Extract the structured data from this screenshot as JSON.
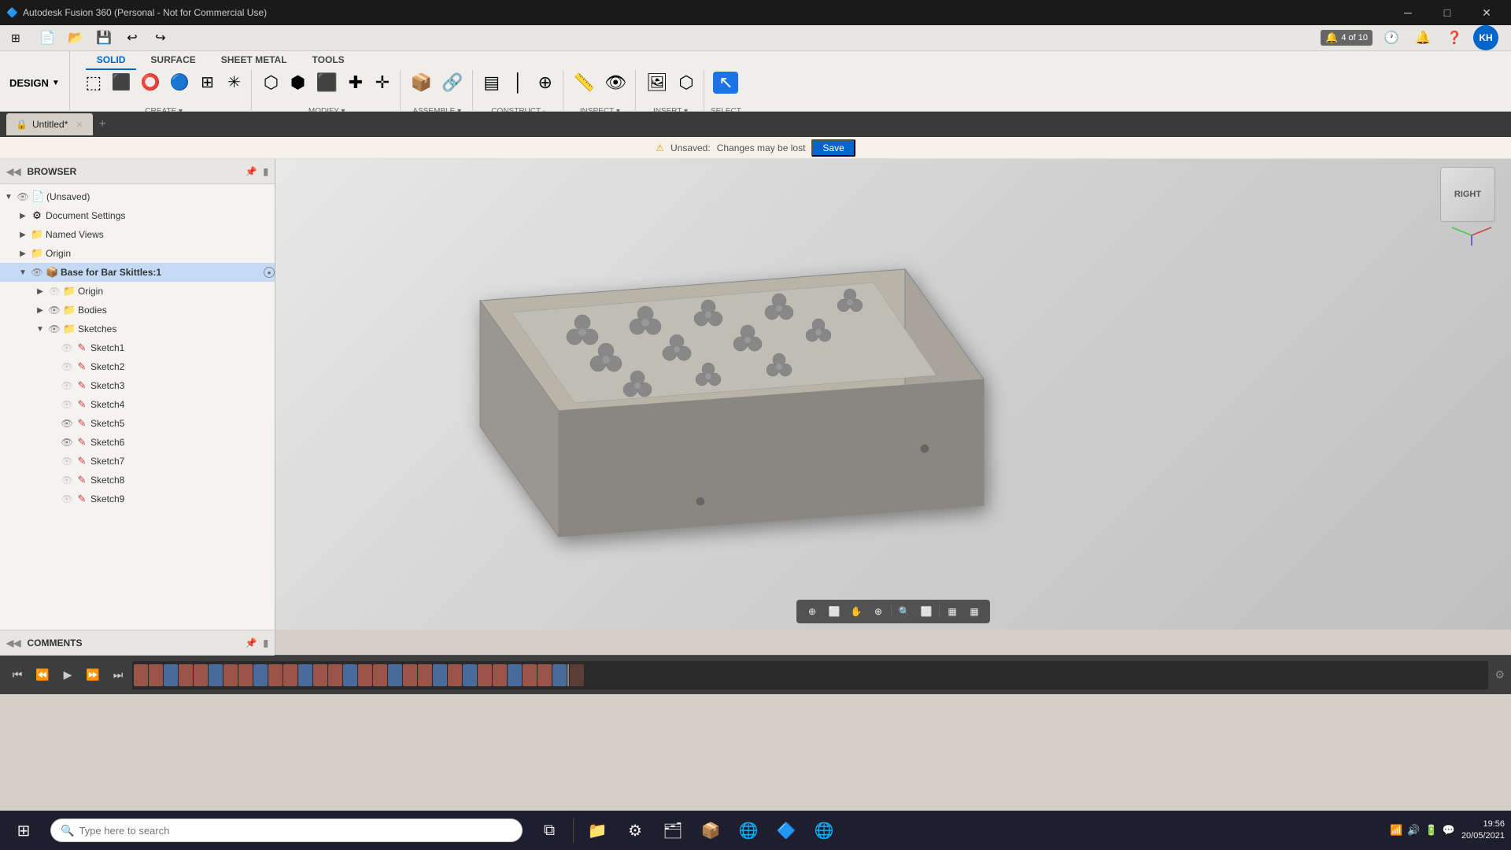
{
  "titlebar": {
    "title": "Autodesk Fusion 360 (Personal - Not for Commercial Use)",
    "icon": "🔷",
    "win_controls": [
      "─",
      "□",
      "✕"
    ]
  },
  "ribbon": {
    "design_label": "DESIGN",
    "tabs": [
      "SOLID",
      "SURFACE",
      "SHEET METAL",
      "TOOLS"
    ],
    "active_tab": "SOLID",
    "groups": {
      "create": {
        "label": "CREATE",
        "items": [
          "new-body",
          "extrude",
          "revolve",
          "sweep",
          "loft",
          "rib",
          "move-copy"
        ]
      },
      "modify": {
        "label": "MODIFY",
        "items": [
          "press-pull",
          "fillet",
          "chamfer",
          "shell",
          "draft",
          "scale",
          "combine"
        ]
      },
      "assemble": {
        "label": "ASSEMBLE",
        "items": [
          "new-component",
          "joint",
          "joint-origin"
        ]
      },
      "construct": {
        "label": "CONSTRUCT",
        "items": [
          "offset-plane",
          "plane-angle",
          "plane-tangent",
          "midplane",
          "axis-cylinder"
        ]
      },
      "inspect": {
        "label": "INSPECT",
        "items": [
          "measure",
          "display-settings"
        ]
      },
      "insert": {
        "label": "INSERT",
        "items": [
          "decal",
          "canvas",
          "insert-mesh"
        ]
      },
      "select": {
        "label": "SELECT",
        "items": [
          "select-tool"
        ]
      }
    }
  },
  "tabbar": {
    "tabs": [
      {
        "id": "untitled",
        "label": "Untitled*",
        "active": true
      }
    ],
    "tab_count": "4 of 10"
  },
  "unsaved": {
    "icon": "⚠",
    "message": "Unsaved:",
    "detail": "Changes may be lost",
    "save_label": "Save"
  },
  "browser": {
    "title": "BROWSER",
    "tree": [
      {
        "id": "root",
        "indent": 0,
        "label": "(Unsaved)",
        "arrow": "▼",
        "icon": "📄",
        "visible": true,
        "bold": false
      },
      {
        "id": "doc-settings",
        "indent": 1,
        "label": "Document Settings",
        "arrow": "▶",
        "icon": "⚙",
        "visible": false,
        "bold": false
      },
      {
        "id": "named-views",
        "indent": 1,
        "label": "Named Views",
        "arrow": "▶",
        "icon": "📁",
        "visible": false,
        "bold": false
      },
      {
        "id": "origin",
        "indent": 1,
        "label": "Origin",
        "arrow": "▶",
        "icon": "📁",
        "visible": false,
        "bold": false
      },
      {
        "id": "base-comp",
        "indent": 1,
        "label": "Base for Bar Skittles:1",
        "arrow": "▼",
        "icon": "📦",
        "visible": true,
        "bold": true,
        "active": true
      },
      {
        "id": "origin2",
        "indent": 2,
        "label": "Origin",
        "arrow": "▶",
        "icon": "📁",
        "visible": false,
        "bold": false
      },
      {
        "id": "bodies",
        "indent": 2,
        "label": "Bodies",
        "arrow": "▶",
        "icon": "📁",
        "visible": true,
        "bold": false
      },
      {
        "id": "sketches",
        "indent": 2,
        "label": "Sketches",
        "arrow": "▼",
        "icon": "📁",
        "visible": true,
        "bold": false
      },
      {
        "id": "sketch1",
        "indent": 3,
        "label": "Sketch1",
        "arrow": "",
        "icon": "✏",
        "visible": false,
        "bold": false,
        "sketch": true
      },
      {
        "id": "sketch2",
        "indent": 3,
        "label": "Sketch2",
        "arrow": "",
        "icon": "✏",
        "visible": false,
        "bold": false,
        "sketch": true
      },
      {
        "id": "sketch3",
        "indent": 3,
        "label": "Sketch3",
        "arrow": "",
        "icon": "✏",
        "visible": false,
        "bold": false,
        "sketch": true
      },
      {
        "id": "sketch4",
        "indent": 3,
        "label": "Sketch4",
        "arrow": "",
        "icon": "✏",
        "visible": false,
        "bold": false,
        "sketch": true
      },
      {
        "id": "sketch5",
        "indent": 3,
        "label": "Sketch5",
        "arrow": "",
        "icon": "✏",
        "visible": true,
        "bold": false,
        "sketch": true
      },
      {
        "id": "sketch6",
        "indent": 3,
        "label": "Sketch6",
        "arrow": "",
        "icon": "✏",
        "visible": true,
        "bold": false,
        "sketch": true
      },
      {
        "id": "sketch7",
        "indent": 3,
        "label": "Sketch7",
        "arrow": "",
        "icon": "✏",
        "visible": false,
        "bold": false,
        "sketch": true
      },
      {
        "id": "sketch8",
        "indent": 3,
        "label": "Sketch8",
        "arrow": "",
        "icon": "✏",
        "visible": false,
        "bold": false,
        "sketch": true
      },
      {
        "id": "sketch9",
        "indent": 3,
        "label": "Sketch9",
        "arrow": "",
        "icon": "✏",
        "visible": false,
        "bold": false,
        "sketch": true
      }
    ]
  },
  "comments": {
    "title": "COMMENTS"
  },
  "viewport": {
    "model_name": "Base for Bar Skittles",
    "view": "Perspective"
  },
  "viewcube": {
    "label": "RIGHT"
  },
  "timeline": {
    "play_controls": [
      "⏮",
      "⏪",
      "▶",
      "⏩",
      "⏭"
    ],
    "items_count": 30
  },
  "bottom_toolbar": {
    "tools": [
      "⊕",
      "⬜",
      "✋",
      "⊕",
      "🔍",
      "⬜",
      "▦",
      "▦"
    ]
  },
  "taskbar": {
    "start_label": "⊞",
    "search_placeholder": "Type here to search",
    "apps": [
      {
        "name": "task-view",
        "icon": "⧉"
      },
      {
        "name": "file-explorer",
        "icon": "📁"
      },
      {
        "name": "settings",
        "icon": "⚙"
      },
      {
        "name": "file-manager",
        "icon": "🗂"
      },
      {
        "name": "browser1",
        "icon": "📦"
      },
      {
        "name": "chrome",
        "icon": "🌐"
      },
      {
        "name": "fusion360",
        "icon": "🔷"
      },
      {
        "name": "edge",
        "icon": "🌐"
      }
    ],
    "sys_tray": {
      "time": "19:56",
      "date": "20/05/2021"
    }
  },
  "construct_label": "CONSTRUCT -",
  "select_label": "SELECT"
}
